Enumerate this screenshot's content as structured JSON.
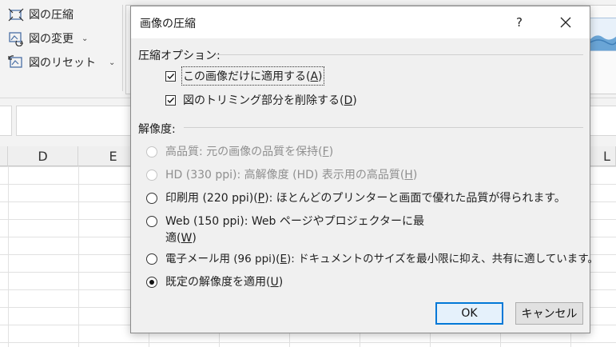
{
  "ribbon": {
    "items": [
      {
        "label": "図の圧縮",
        "icon": "compress-pictures-icon"
      },
      {
        "label": "図の変更",
        "icon": "change-picture-icon",
        "has_menu": true
      },
      {
        "label": "図のリセット",
        "icon": "reset-picture-icon",
        "has_menu": true
      }
    ]
  },
  "grid": {
    "columns": [
      "D",
      "E",
      "L"
    ]
  },
  "dialog": {
    "title": "画像の圧縮",
    "help": "?",
    "compress_options_label": "圧縮オプション:",
    "checkboxes": [
      {
        "text": "この画像だけに適用する(",
        "key": "A",
        "end": ")",
        "checked": true,
        "focused": true
      },
      {
        "text": "図のトリミング部分を削除する(",
        "key": "D",
        "end": ")",
        "checked": true,
        "focused": false
      }
    ],
    "resolution_label": "解像度:",
    "radios": [
      {
        "text": "高品質: 元の画像の品質を保持(",
        "key": "F",
        "end": ")",
        "disabled": true,
        "selected": false
      },
      {
        "text": "HD (330 ppi): 高解像度 (HD) 表示用の高品質(",
        "key": "H",
        "end": ")",
        "disabled": true,
        "selected": false
      },
      {
        "text": "印刷用 (220 ppi)(",
        "key": "P",
        "end": "): ほとんどのプリンターと画面で優れた品質が得られます。",
        "disabled": false,
        "selected": false
      },
      {
        "text": "Web (150 ppi): Web ページやプロジェクターに最",
        "line2": "適(",
        "key": "W",
        "end": ")",
        "disabled": false,
        "selected": false
      },
      {
        "text": "電子メール用 (96 ppi)(",
        "key": "E",
        "end": "): ドキュメントのサイズを最小限に抑え、共有に適しています。",
        "disabled": false,
        "selected": false
      },
      {
        "text": "既定の解像度を適用(",
        "key": "U",
        "end": ")",
        "disabled": false,
        "selected": true
      }
    ],
    "ok_label": "OK",
    "cancel_label": "キャンセル"
  },
  "colors": {
    "accent": "#0078d7",
    "dialog_bg": "#f0f0f0",
    "disabled_text": "#8f8f8f"
  }
}
